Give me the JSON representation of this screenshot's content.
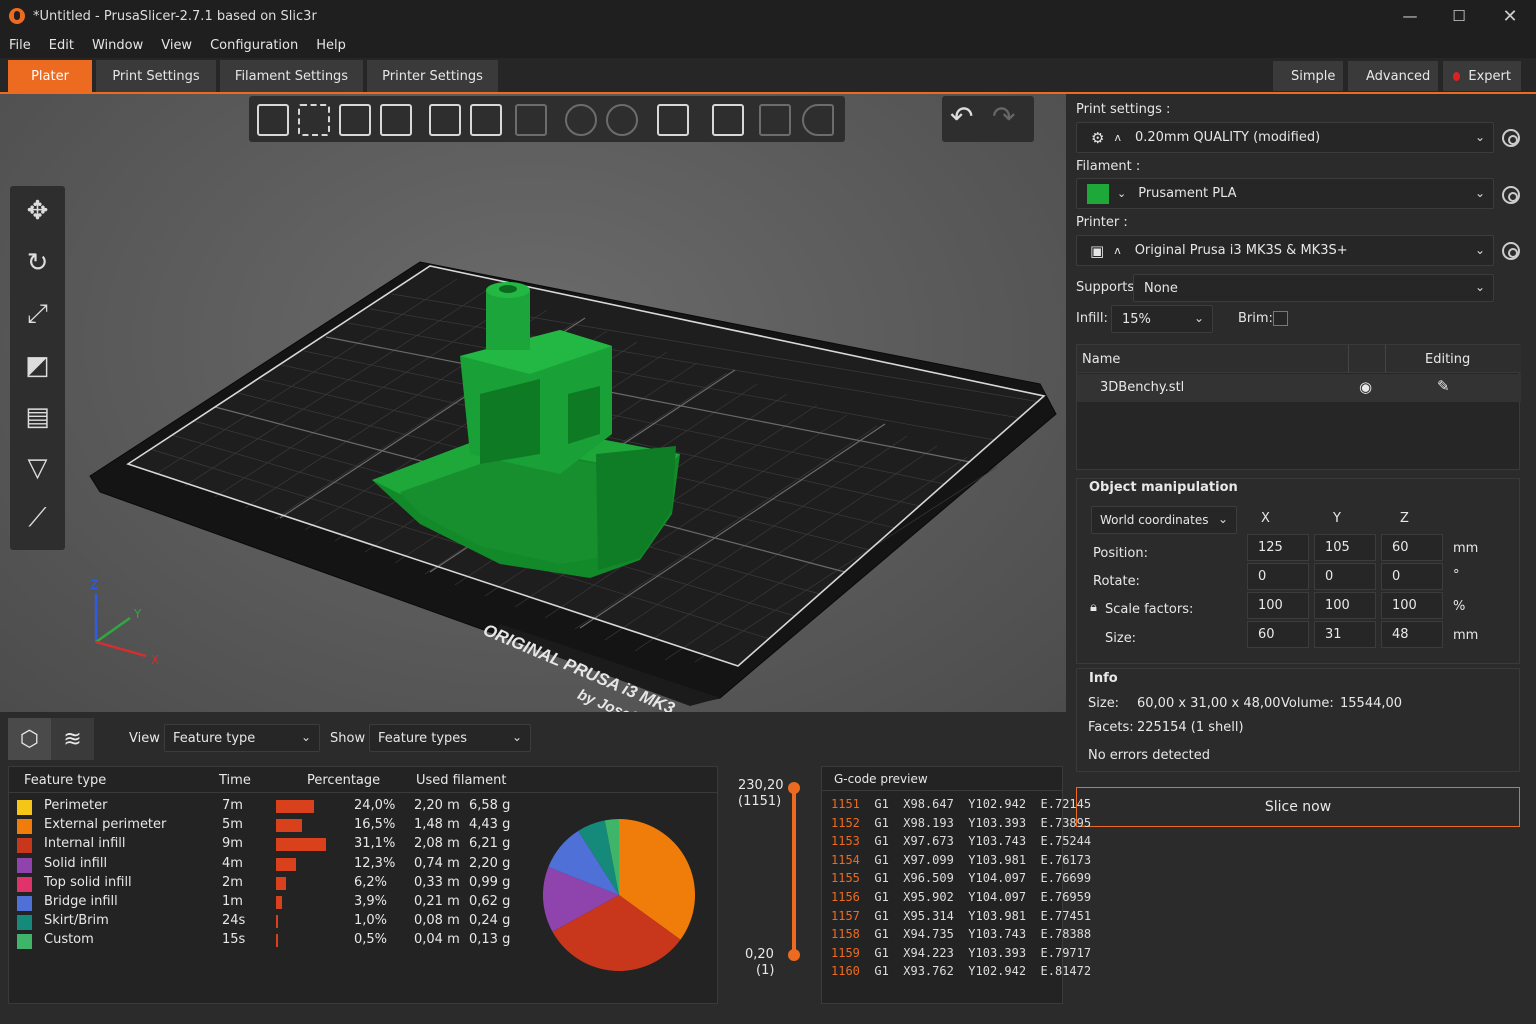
{
  "window": {
    "title": "*Untitled - PrusaSlicer-2.7.1 based on Slic3r"
  },
  "menu": [
    "File",
    "Edit",
    "Window",
    "View",
    "Configuration",
    "Help"
  ],
  "tabs": [
    "Plater",
    "Print Settings",
    "Filament Settings",
    "Printer Settings"
  ],
  "modes": [
    {
      "label": "Simple",
      "color": "#34b84a"
    },
    {
      "label": "Advanced",
      "color": "#f2c94c"
    },
    {
      "label": "Expert",
      "color": "#e02020"
    }
  ],
  "bed": {
    "line1": "ORIGINAL PRUSA i3 MK3",
    "line2": "by Josef Prusa"
  },
  "axes": {
    "z": "Z",
    "y": "Y",
    "x": "X"
  },
  "settings": {
    "print_label": "Print settings :",
    "print_value": "0.20mm QUALITY (modified)",
    "filament_label": "Filament :",
    "filament_value": "Prusament PLA",
    "filament_color": "#1fa83a",
    "printer_label": "Printer :",
    "printer_value": "Original Prusa i3 MK3S & MK3S+",
    "supports_label": "Supports:",
    "supports_value": "None",
    "infill_label": "Infill:",
    "infill_value": "15%",
    "brim_label": "Brim:"
  },
  "objects": {
    "col_name": "Name",
    "col_editing": "Editing",
    "rows": [
      {
        "name": "3DBenchy.stl"
      }
    ]
  },
  "manip": {
    "title": "Object manipulation",
    "coords": "World coordinates",
    "x": "X",
    "y": "Y",
    "z": "Z",
    "rows": [
      {
        "label": "Position:",
        "x": "125",
        "y": "105",
        "z": "60",
        "unit": "mm"
      },
      {
        "label": "Rotate:",
        "x": "0",
        "y": "0",
        "z": "0",
        "unit": "°"
      },
      {
        "label": "Scale factors:",
        "x": "100",
        "y": "100",
        "z": "100",
        "unit": "%"
      },
      {
        "label": "Size:",
        "x": "60",
        "y": "31",
        "z": "48",
        "unit": "mm"
      }
    ]
  },
  "info": {
    "title": "Info",
    "size_label": "Size:",
    "size_value": "60,00 x 31,00 x 48,00",
    "volume_label": "Volume:",
    "volume_value": "15544,00",
    "facets_label": "Facets:",
    "facets_value": "225154 (1 shell)",
    "errors": "No errors detected"
  },
  "slice_button": "Slice now",
  "preview": {
    "view_label": "View",
    "view_value": "Feature type",
    "show_label": "Show",
    "show_value": "Feature types"
  },
  "legend": {
    "headers": {
      "type": "Feature type",
      "time": "Time",
      "percentage": "Percentage",
      "filament": "Used filament"
    },
    "rows": [
      {
        "name": "Perimeter",
        "time": "7m",
        "pct": "24,0%",
        "len": "2,20 m",
        "mass": "6,58 g",
        "frac": 0.24,
        "color": "#f5c518"
      },
      {
        "name": "External perimeter",
        "time": "5m",
        "pct": "16,5%",
        "len": "1,48 m",
        "mass": "4,43 g",
        "frac": 0.165,
        "color": "#f07d0a"
      },
      {
        "name": "Internal infill",
        "time": "9m",
        "pct": "31,1%",
        "len": "2,08 m",
        "mass": "6,21 g",
        "frac": 0.311,
        "color": "#c8361c"
      },
      {
        "name": "Solid infill",
        "time": "4m",
        "pct": "12,3%",
        "len": "0,74 m",
        "mass": "2,20 g",
        "frac": 0.123,
        "color": "#8f44ad"
      },
      {
        "name": "Top solid infill",
        "time": "2m",
        "pct": "6,2%",
        "len": "0,33 m",
        "mass": "0,99 g",
        "frac": 0.062,
        "color": "#e0336b"
      },
      {
        "name": "Bridge infill",
        "time": "1m",
        "pct": "3,9%",
        "len": "0,21 m",
        "mass": "0,62 g",
        "frac": 0.039,
        "color": "#4f70d6"
      },
      {
        "name": "Skirt/Brim",
        "time": "24s",
        "pct": "1,0%",
        "len": "0,08 m",
        "mass": "0,24 g",
        "frac": 0.01,
        "color": "#168a7a"
      },
      {
        "name": "Custom",
        "time": "15s",
        "pct": "0,5%",
        "len": "0,04 m",
        "mass": "0,13 g",
        "frac": 0.005,
        "color": "#3fb56a"
      }
    ]
  },
  "chart_data": {
    "type": "pie",
    "categories": [
      "Perimeter",
      "External perimeter",
      "Internal infill",
      "Solid infill",
      "Top solid infill",
      "Bridge infill",
      "Skirt/Brim",
      "Custom"
    ],
    "values": [
      24.0,
      16.5,
      31.1,
      12.3,
      6.2,
      3.9,
      1.0,
      0.5
    ],
    "pie_colors": [
      "#f07d0a",
      "#c8361c",
      "#8f44ad",
      "#4f70d6",
      "#168a7a",
      "#3fb56a"
    ],
    "pie_values": [
      35,
      32,
      14,
      10,
      6,
      3
    ]
  },
  "layers": {
    "top": "230,20",
    "top_n": "(1151)",
    "bottom": "0,20",
    "bottom_n": "(1)"
  },
  "gcode": {
    "title": "G-code preview",
    "lines": [
      {
        "n": "1151",
        "code": "G1  X98.647  Y102.942  E.72145"
      },
      {
        "n": "1152",
        "code": "G1  X98.193  Y103.393  E.73895"
      },
      {
        "n": "1153",
        "code": "G1  X97.673  Y103.743  E.75244"
      },
      {
        "n": "1154",
        "code": "G1  X97.099  Y103.981  E.76173"
      },
      {
        "n": "1155",
        "code": "G1  X96.509  Y104.097  E.76699"
      },
      {
        "n": "1156",
        "code": "G1  X95.902  Y104.097  E.76959"
      },
      {
        "n": "1157",
        "code": "G1  X95.314  Y103.981  E.77451"
      },
      {
        "n": "1158",
        "code": "G1  X94.735  Y103.743  E.78388"
      },
      {
        "n": "1159",
        "code": "G1  X94.223  Y103.393  E.79717"
      },
      {
        "n": "1160",
        "code": "G1  X93.762  Y102.942  E.81472"
      }
    ]
  }
}
